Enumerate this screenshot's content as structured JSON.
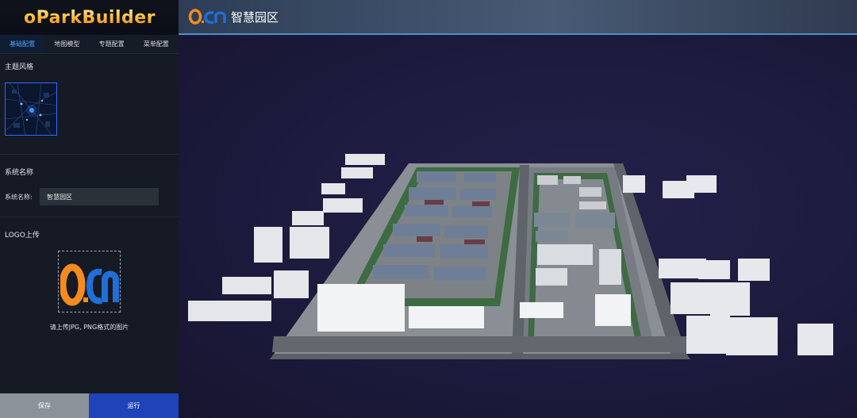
{
  "brand": {
    "name": "oParkBuilder"
  },
  "tabs": [
    {
      "label": "基础配置",
      "active": true
    },
    {
      "label": "地图模型",
      "active": false
    },
    {
      "label": "专题配置",
      "active": false
    },
    {
      "label": "菜单配置",
      "active": false
    }
  ],
  "theme_section": {
    "title": "主题风格"
  },
  "system_section": {
    "title": "系统名称",
    "field_label": "系统名称:",
    "field_value": "智慧园区"
  },
  "logo_section": {
    "title": "LOGO上传",
    "hint": "请上传JPG, PNG格式的图片"
  },
  "actions": {
    "save_label": "保存",
    "run_label": "运行"
  },
  "header": {
    "logo_text": "O.cn",
    "title": "智慧园区"
  },
  "colors": {
    "accent": "#2f6cff",
    "run_button": "#1f43b8",
    "save_button": "#8c9299",
    "logo_orange": "#f58a1f",
    "logo_blue": "#1f6fd6"
  },
  "icons": {
    "theme_thumbnail": "dark-map-thumbnail",
    "logo_preview": "ocn-logo"
  }
}
